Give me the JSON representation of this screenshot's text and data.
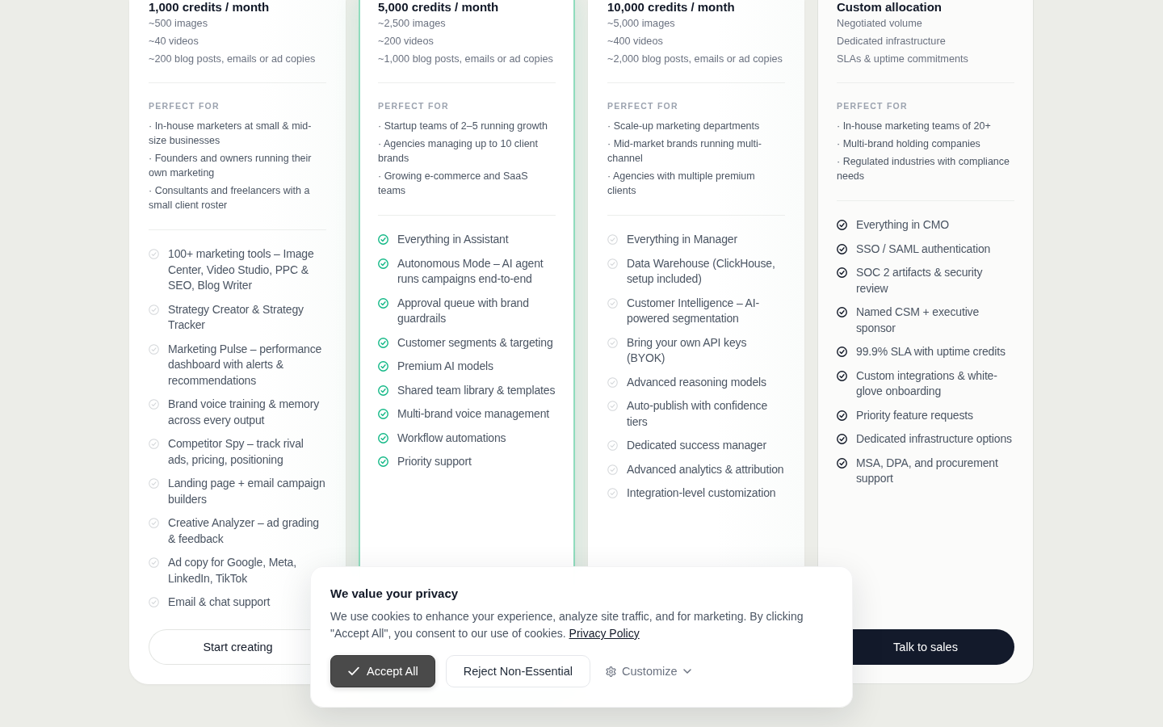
{
  "plans": [
    {
      "kind": "standard",
      "allowance": "1,000 credits / month",
      "usage": [
        "~500 images",
        "~40 videos",
        "~200 blog posts, emails or ad copies"
      ],
      "perfect_for_heading": "PERFECT FOR",
      "perfect_for": [
        "· In-house marketers at small & mid-size businesses",
        "· Founders and owners running their own marketing",
        "· Consultants and freelancers with a small client roster"
      ],
      "features": [
        "100+ marketing tools – Image Center, Video Studio, PPC & SEO, Blog Writer",
        "Strategy Creator & Strategy Tracker",
        "Marketing Pulse – performance dashboard with alerts & recommendations",
        "Brand voice training & memory across every output",
        "Competitor Spy – track rival ads, pricing, positioning",
        "Landing page + email campaign builders",
        "Creative Analyzer – ad grading & feedback",
        "Ad copy for Google, Meta, LinkedIn, TikTok",
        "Email & chat support"
      ],
      "button": {
        "label": "Start creating"
      }
    },
    {
      "kind": "featured",
      "allowance": "5,000 credits / month",
      "usage": [
        "~2,500 images",
        "~200 videos",
        "~1,000 blog posts, emails or ad copies"
      ],
      "perfect_for_heading": "PERFECT FOR",
      "perfect_for": [
        "· Startup teams of 2–5 running growth",
        "· Agencies managing up to 10 client brands",
        "· Growing e-commerce and SaaS teams"
      ],
      "features": [
        "Everything in Assistant",
        "Autonomous Mode – AI agent runs campaigns end-to-end",
        "Approval queue with brand guardrails",
        "Customer segments & targeting",
        "Premium AI models",
        "Shared team library & templates",
        "Multi-brand voice management",
        "Workflow automations",
        "Priority support"
      ]
    },
    {
      "kind": "standard",
      "allowance": "10,000 credits / month",
      "usage": [
        "~5,000 images",
        "~400 videos",
        "~2,000 blog posts, emails or ad copies"
      ],
      "perfect_for_heading": "PERFECT FOR",
      "perfect_for": [
        "· Scale-up marketing departments",
        "· Mid-market brands running multi-channel",
        "· Agencies with multiple premium clients"
      ],
      "features": [
        "Everything in Manager",
        "Data Warehouse (ClickHouse, setup included)",
        "Customer Intelligence – AI-powered segmentation",
        "Bring your own API keys (BYOK)",
        "Advanced reasoning models",
        "Auto-publish with confidence tiers",
        "Dedicated success manager",
        "Advanced analytics & attribution",
        "Integration-level customization"
      ]
    },
    {
      "kind": "enterprise",
      "allowance": "Custom allocation",
      "usage": [
        "Negotiated volume",
        "Dedicated infrastructure",
        "SLAs & uptime commitments"
      ],
      "perfect_for_heading": "PERFECT FOR",
      "perfect_for": [
        "· In-house marketing teams of 20+",
        "· Multi-brand holding companies",
        "· Regulated industries with compliance needs"
      ],
      "features": [
        "Everything in CMO",
        "SSO / SAML authentication",
        "SOC 2 artifacts & security review",
        "Named CSM + executive sponsor",
        "99.9% SLA with uptime credits",
        "Custom integrations & white-glove onboarding",
        "Priority feature requests",
        "Dedicated infrastructure options",
        "MSA, DPA, and procurement support"
      ],
      "button": {
        "label": "Talk to sales"
      }
    }
  ],
  "cookie_banner": {
    "title": "We value your privacy",
    "text": "We use cookies to enhance your experience, analyze site traffic, and for marketing. By clicking \"Accept All\", you consent to our use of cookies.",
    "link": "Privacy Policy",
    "buttons": [
      {
        "kind": "accept",
        "label": "Accept All"
      },
      {
        "kind": "reject",
        "label": "Reject Non-Essential"
      },
      {
        "kind": "customize",
        "label": "Customize"
      }
    ]
  }
}
